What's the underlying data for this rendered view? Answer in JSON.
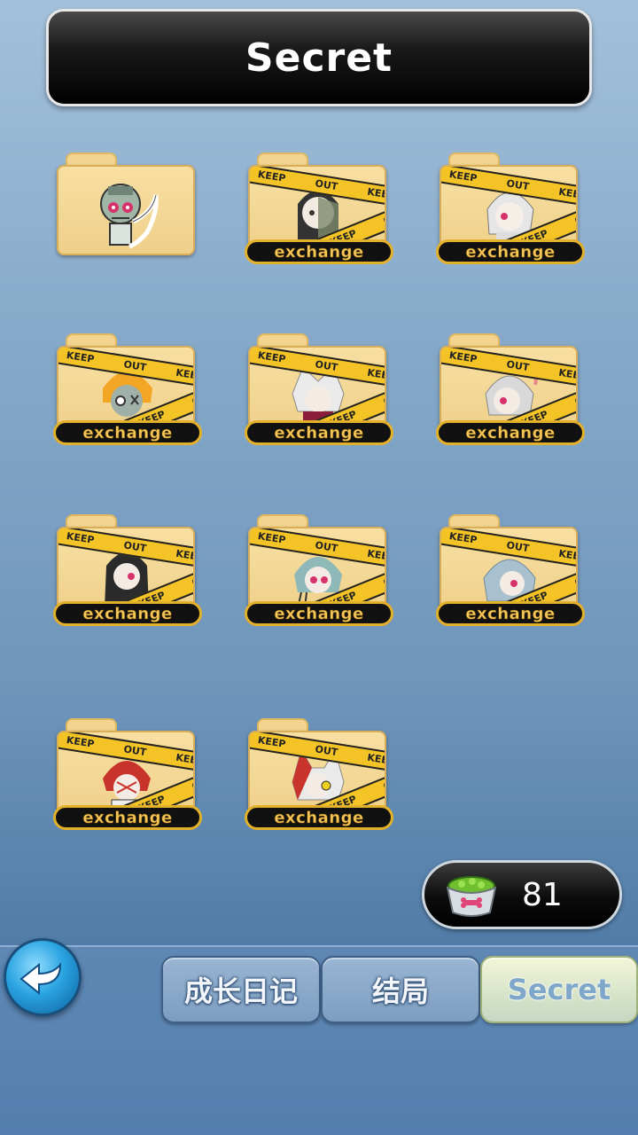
{
  "header": {
    "title": "Secret"
  },
  "secrets": {
    "exchange_label": "exchange",
    "tape_text": "KEEP OUT KEEP OUT",
    "items": [
      {
        "id": 1,
        "unlocked": true
      },
      {
        "id": 2,
        "unlocked": false
      },
      {
        "id": 3,
        "unlocked": false
      },
      {
        "id": 4,
        "unlocked": false
      },
      {
        "id": 5,
        "unlocked": false
      },
      {
        "id": 6,
        "unlocked": false
      },
      {
        "id": 7,
        "unlocked": false
      },
      {
        "id": 8,
        "unlocked": false
      },
      {
        "id": 9,
        "unlocked": false
      },
      {
        "id": 10,
        "unlocked": false
      },
      {
        "id": 11,
        "unlocked": false
      }
    ]
  },
  "food_counter": {
    "icon": "food-bowl-icon",
    "value": "81"
  },
  "nav": {
    "back_icon": "back-arrow-icon",
    "tabs": [
      {
        "label": "成长日记",
        "active": false
      },
      {
        "label": "结局",
        "active": false
      },
      {
        "label": "Secret",
        "active": true
      }
    ]
  },
  "colors": {
    "tape_yellow": "#f4c326",
    "exchange_gold": "#f4c65a",
    "folder": "#f8dfa2"
  }
}
